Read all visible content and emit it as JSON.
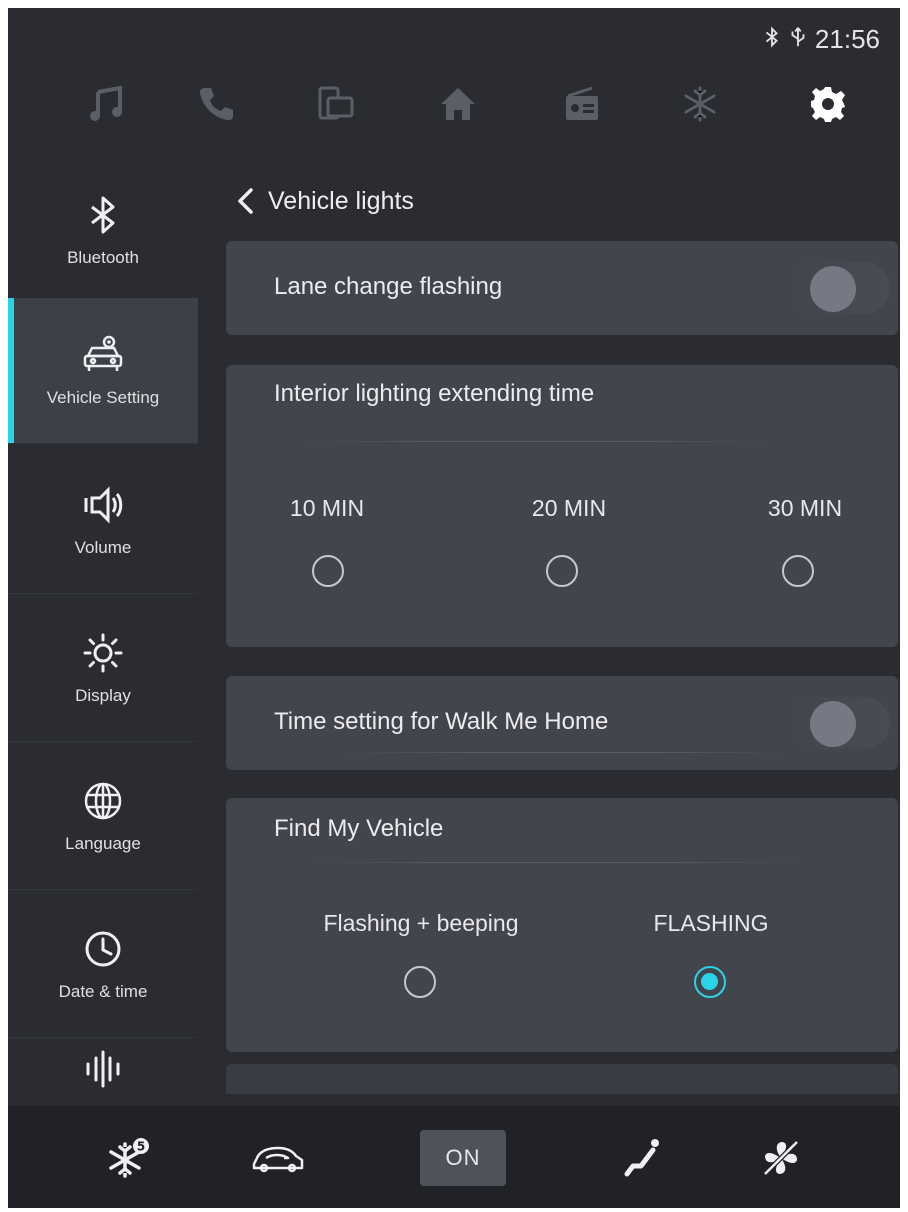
{
  "status": {
    "time": "21:56",
    "icons": [
      "bluetooth-icon",
      "usb-icon"
    ]
  },
  "top_nav": {
    "items": [
      {
        "name": "music",
        "icon": "music-note-icon",
        "active": false
      },
      {
        "name": "phone",
        "icon": "phone-icon",
        "active": false
      },
      {
        "name": "apps",
        "icon": "screen-mirror-icon",
        "active": false
      },
      {
        "name": "home",
        "icon": "home-icon",
        "active": false
      },
      {
        "name": "radio",
        "icon": "radio-icon",
        "active": false
      },
      {
        "name": "climate",
        "icon": "snowflake-icon",
        "active": false
      },
      {
        "name": "settings",
        "icon": "gear-icon",
        "active": true
      }
    ]
  },
  "sidebar": {
    "items": [
      {
        "label": "Bluetooth",
        "icon": "bluetooth-icon"
      },
      {
        "label": "Vehicle Setting",
        "icon": "car-gear-icon",
        "active": true
      },
      {
        "label": "Volume",
        "icon": "speaker-icon"
      },
      {
        "label": "Display",
        "icon": "brightness-icon"
      },
      {
        "label": "Language",
        "icon": "globe-icon"
      },
      {
        "label": "Date & time",
        "icon": "clock-icon"
      },
      {
        "label": "",
        "icon": "sound-wave-icon"
      }
    ]
  },
  "page": {
    "title": "Vehicle lights"
  },
  "cards": {
    "lane_change": {
      "title": "Lane change flashing",
      "toggle_on": false
    },
    "interior": {
      "title": "Interior lighting extending time",
      "options": [
        "10 MIN",
        "20 MIN",
        "30 MIN"
      ],
      "selected": -1
    },
    "walk_me_home": {
      "title": "Time setting for Walk Me Home",
      "toggle_on": false
    },
    "find_vehicle": {
      "title": "Find My Vehicle",
      "options": [
        "Flashing + beeping",
        "FLASHING"
      ],
      "selected": 1
    }
  },
  "bottom_bar": {
    "items": [
      {
        "icon": "snowflake-badge-icon",
        "badge": "5"
      },
      {
        "icon": "car-recirculation-icon"
      },
      {
        "label": "ON"
      },
      {
        "icon": "seat-heat-icon"
      },
      {
        "icon": "fan-off-icon"
      }
    ]
  },
  "colors": {
    "accent": "#2ad4e8",
    "background": "#2a2c32",
    "card": "#43454d"
  }
}
